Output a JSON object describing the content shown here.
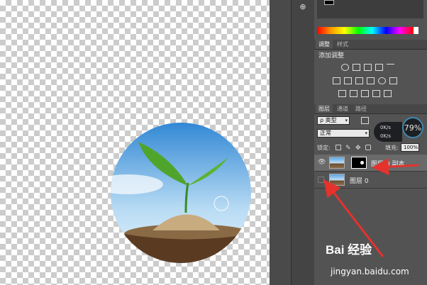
{
  "adjustments_panel": {
    "tab_adjust": "调整",
    "tab_styles": "样式",
    "title": "添加调整"
  },
  "layers_panel": {
    "tab_layers": "图层",
    "tab_channels": "通道",
    "tab_paths": "路径",
    "kind_filter": "ρ 类型",
    "blend_mode": "正常",
    "lock_label": "锁定:",
    "fill_label": "填充:",
    "fill_value": "100%",
    "layers": [
      {
        "name": "图层 0 副本",
        "has_mask": true,
        "selected": true
      },
      {
        "name": "图层 0",
        "has_mask": false,
        "selected": false
      }
    ]
  },
  "system_monitor": {
    "upload": "0K/s",
    "download": "0K/s",
    "usage": "79%"
  },
  "watermark": {
    "logo": "Bai 经验",
    "url": "jingyan.baidu.com"
  },
  "colors": {
    "panel_bg": "#535353",
    "arrow": "#e5322d",
    "gauge_ring": "#3e87ad"
  }
}
